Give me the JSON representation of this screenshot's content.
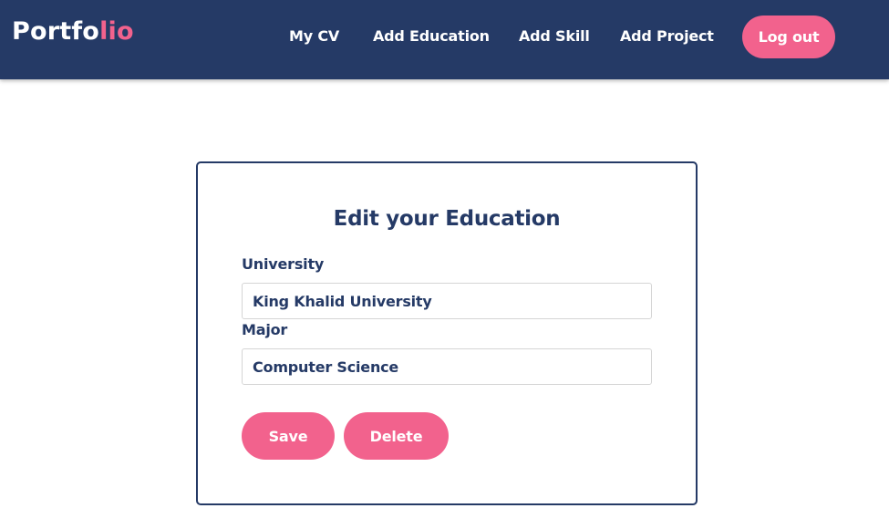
{
  "navbar": {
    "brand_prefix": "Portfo",
    "brand_accent": "lio",
    "links": [
      "My CV",
      "Add Education",
      "Add Skill",
      "Add Project"
    ],
    "logout_label": "Log out"
  },
  "form": {
    "title": "Edit your Education",
    "university_label": "University",
    "university_value": "King Khalid University",
    "major_label": "Major",
    "major_value": "Computer Science",
    "save_label": "Save",
    "delete_label": "Delete"
  },
  "colors": {
    "navbar_bg": "#253a66",
    "accent": "#f2628d",
    "text_primary": "#253a66",
    "input_border": "#d5d5d5"
  }
}
